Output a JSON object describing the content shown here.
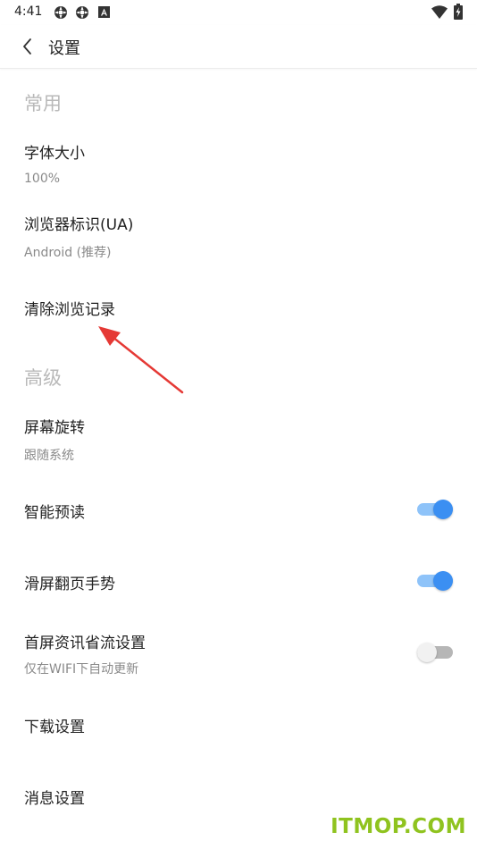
{
  "status_bar": {
    "time": "4:41"
  },
  "app_bar": {
    "title": "设置"
  },
  "sections": {
    "common": {
      "header": "常用",
      "font_size": {
        "title": "字体大小",
        "value": "100%"
      },
      "user_agent": {
        "title": "浏览器标识(UA)",
        "value": "Android (推荐)"
      },
      "clear_history": {
        "title": "清除浏览记录"
      }
    },
    "advanced": {
      "header": "高级",
      "rotation": {
        "title": "屏幕旋转",
        "value": "跟随系统"
      },
      "smart_preread": {
        "title": "智能预读",
        "enabled": true
      },
      "swipe_gesture": {
        "title": "滑屏翻页手势",
        "enabled": true
      },
      "data_saver": {
        "title": "首屏资讯省流设置",
        "subtitle": "仅在WIFI下自动更新",
        "enabled": false
      },
      "download": {
        "title": "下载设置"
      },
      "notifications": {
        "title": "消息设置"
      }
    }
  },
  "colors": {
    "accent": "#3b8ff2",
    "annotation": "#e53935",
    "watermark": "#8fc31f"
  },
  "watermark": "ITMOP.COM"
}
